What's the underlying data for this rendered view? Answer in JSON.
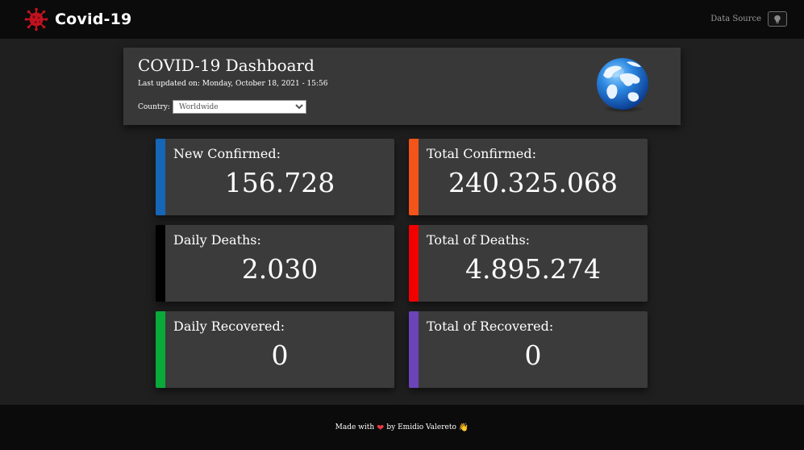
{
  "navbar": {
    "title": "Covid-19",
    "logo_icon": "virus-icon",
    "data_source_label": "Data Source",
    "data_source_icon": "lightbulb-icon"
  },
  "header": {
    "title": "COVID-19 Dashboard",
    "last_updated": "Last updated on: Monday, October 18, 2021 - 15:56",
    "country_label": "Country:",
    "country_selected": "Worldwide",
    "globe_icon": "globe-icon"
  },
  "stats": [
    {
      "label": "New Confirmed:",
      "value": "156.728",
      "color": "#1666b8"
    },
    {
      "label": "Total Confirmed:",
      "value": "240.325.068",
      "color": "#f2541a"
    },
    {
      "label": "Daily Deaths:",
      "value": "2.030",
      "color": "#000000"
    },
    {
      "label": "Total of Deaths:",
      "value": "4.895.274",
      "color": "#f20000"
    },
    {
      "label": "Daily Recovered:",
      "value": "0",
      "color": "#0aaa3a"
    },
    {
      "label": "Total of Recovered:",
      "value": "0",
      "color": "#6a44b8"
    }
  ],
  "footer": {
    "made_with": "Made with",
    "heart": "❤",
    "by": "by Emidio Valereto",
    "wave": "👋"
  }
}
